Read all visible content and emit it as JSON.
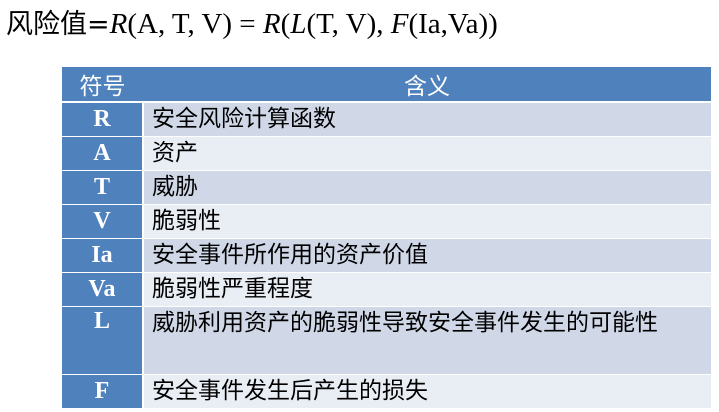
{
  "formula": {
    "lead": "风险值=",
    "p1": "R",
    "p2": "(A, T, V) = ",
    "p3": "R",
    "p4": "(",
    "p5": "L",
    "p6": "(T, V), ",
    "p7": "F",
    "p8": "(Ia,Va))"
  },
  "table": {
    "header": {
      "symbol": "符号",
      "meaning": "含义"
    },
    "rows": [
      {
        "symbol": "R",
        "meaning": "安全风险计算函数"
      },
      {
        "symbol": "A",
        "meaning": "资产"
      },
      {
        "symbol": "T",
        "meaning": "威胁"
      },
      {
        "symbol": "V",
        "meaning": "脆弱性"
      },
      {
        "symbol": "Ia",
        "meaning": "安全事件所作用的资产价值"
      },
      {
        "symbol": "Va",
        "meaning": "脆弱性严重程度"
      },
      {
        "symbol": "L",
        "meaning": "威胁利用资产的脆弱性导致安全事件发生的可能性"
      },
      {
        "symbol": "F",
        "meaning": "安全事件发生后产生的损失"
      }
    ]
  },
  "colors": {
    "header_bg": "#4f81bd",
    "row_bg_dark": "#d0d8e8",
    "row_bg_light": "#e9edf4"
  }
}
